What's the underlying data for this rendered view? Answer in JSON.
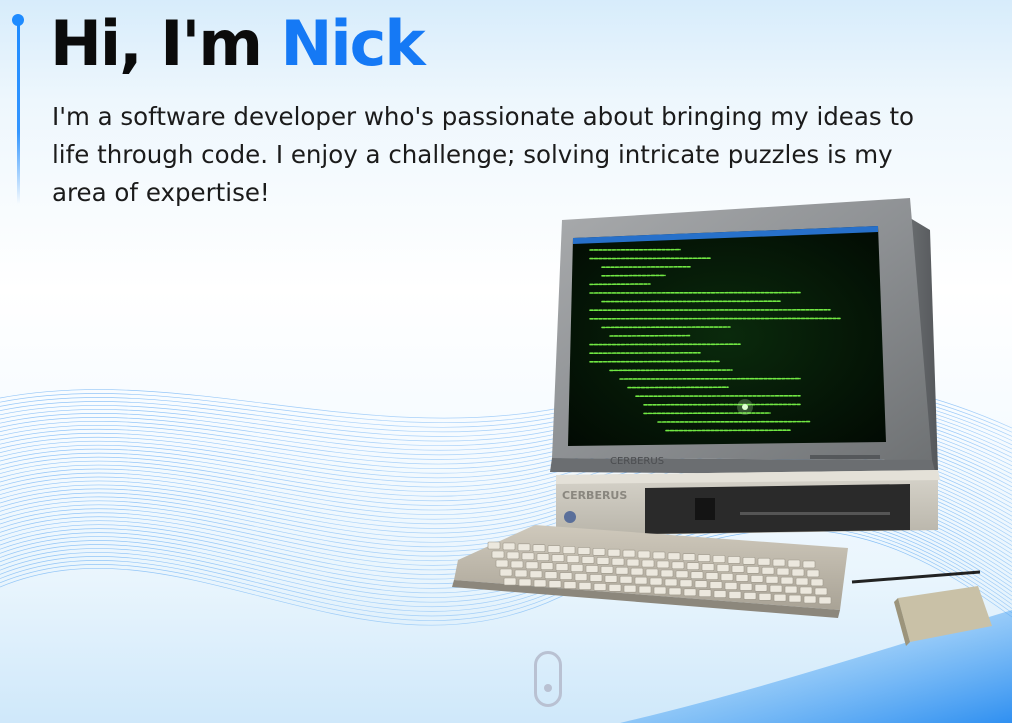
{
  "hero": {
    "title_prefix": "Hi, I'm ",
    "title_name": "Nick",
    "intro": "I'm a software developer who's passionate about bringing my ideas to life through code. I enjoy a challenge; solving intricate puzzles is my area of expertise!"
  },
  "computer": {
    "brand_monitor": "CERBERUS",
    "brand_case": "CERBERUS"
  },
  "icons": {
    "scroll": "mouse-scroll-icon",
    "rail": "timeline-rail-icon"
  },
  "colors": {
    "accent": "#1579f5",
    "text": "#0b0b0b",
    "terminal_text": "#7dff4a",
    "terminal_bg": "#051a05"
  }
}
